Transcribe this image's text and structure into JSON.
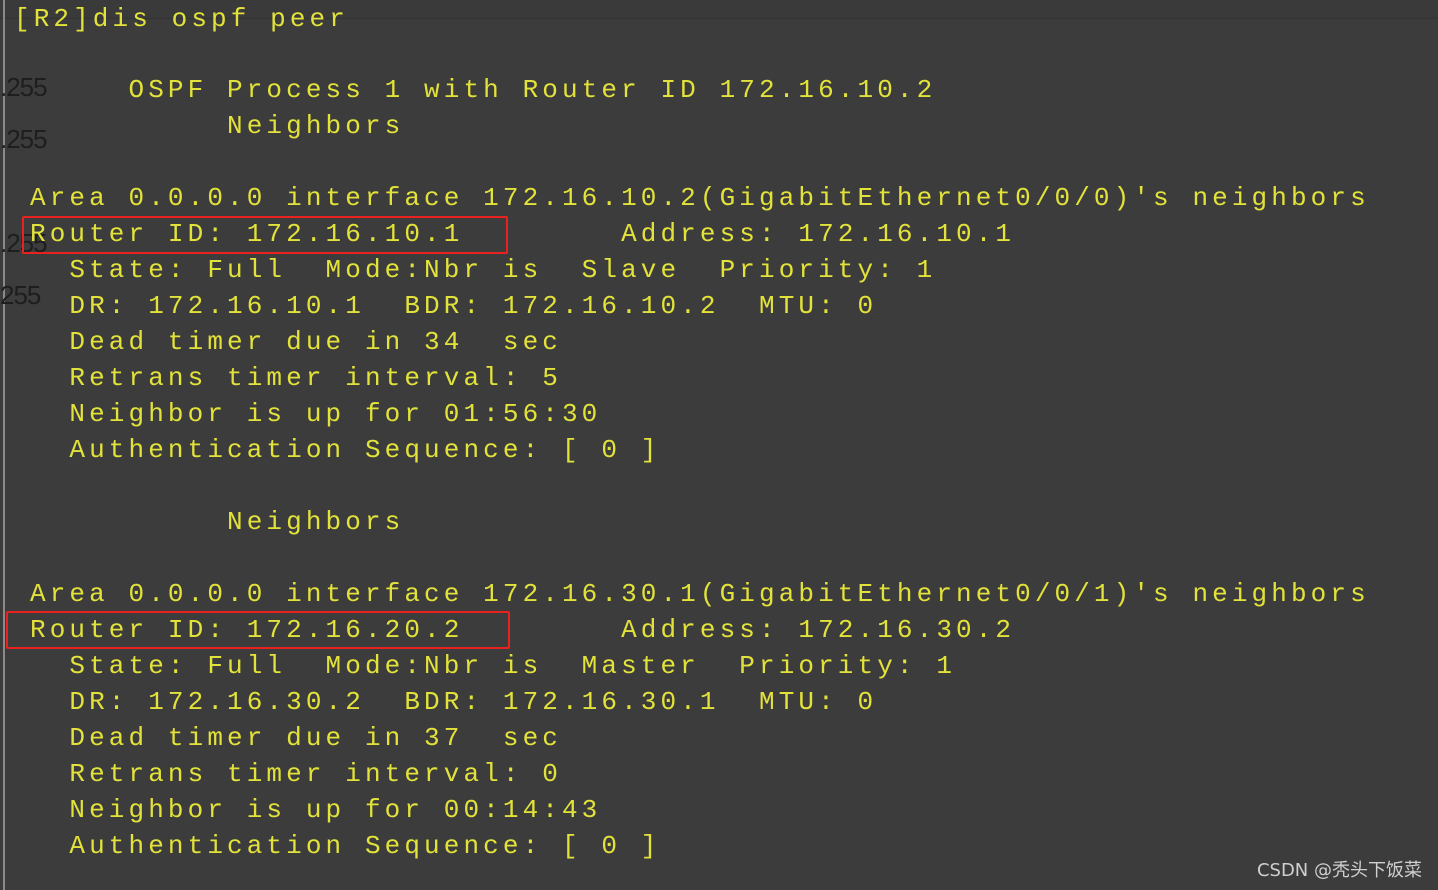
{
  "background_labels": [
    ".255",
    ".255",
    ".255",
    "255"
  ],
  "prompt": "[R2]dis ospf peer",
  "lines": [
    "     OSPF Process 1 with Router ID 172.16.10.2",
    "          Neighbors",
    "Area 0.0.0.0 interface 172.16.10.2(GigabitEthernet0/0/0)'s neighbors",
    "Router ID: 172.16.10.1        Address: 172.16.10.1",
    "  State: Full  Mode:Nbr is  Slave  Priority: 1",
    "  DR: 172.16.10.1  BDR: 172.16.10.2  MTU: 0",
    "  Dead timer due in 34  sec",
    "  Retrans timer interval: 5",
    "  Neighbor is up for 01:56:30",
    "  Authentication Sequence: [ 0 ]",
    "          Neighbors",
    "Area 0.0.0.0 interface 172.16.30.1(GigabitEthernet0/0/1)'s neighbors",
    "Router ID: 172.16.20.2        Address: 172.16.30.2",
    "  State: Full  Mode:Nbr is  Master  Priority: 1",
    "  DR: 172.16.30.2  BDR: 172.16.30.1  MTU: 0",
    "  Dead timer due in 37  sec",
    "  Retrans timer interval: 0",
    "  Neighbor is up for 00:14:43",
    "  Authentication Sequence: [ 0 ]"
  ],
  "colors": {
    "background": "#3c3c3c",
    "text": "#e2e23a",
    "highlight_box": "#e8231f"
  },
  "watermark": "CSDN @秃头下饭菜"
}
